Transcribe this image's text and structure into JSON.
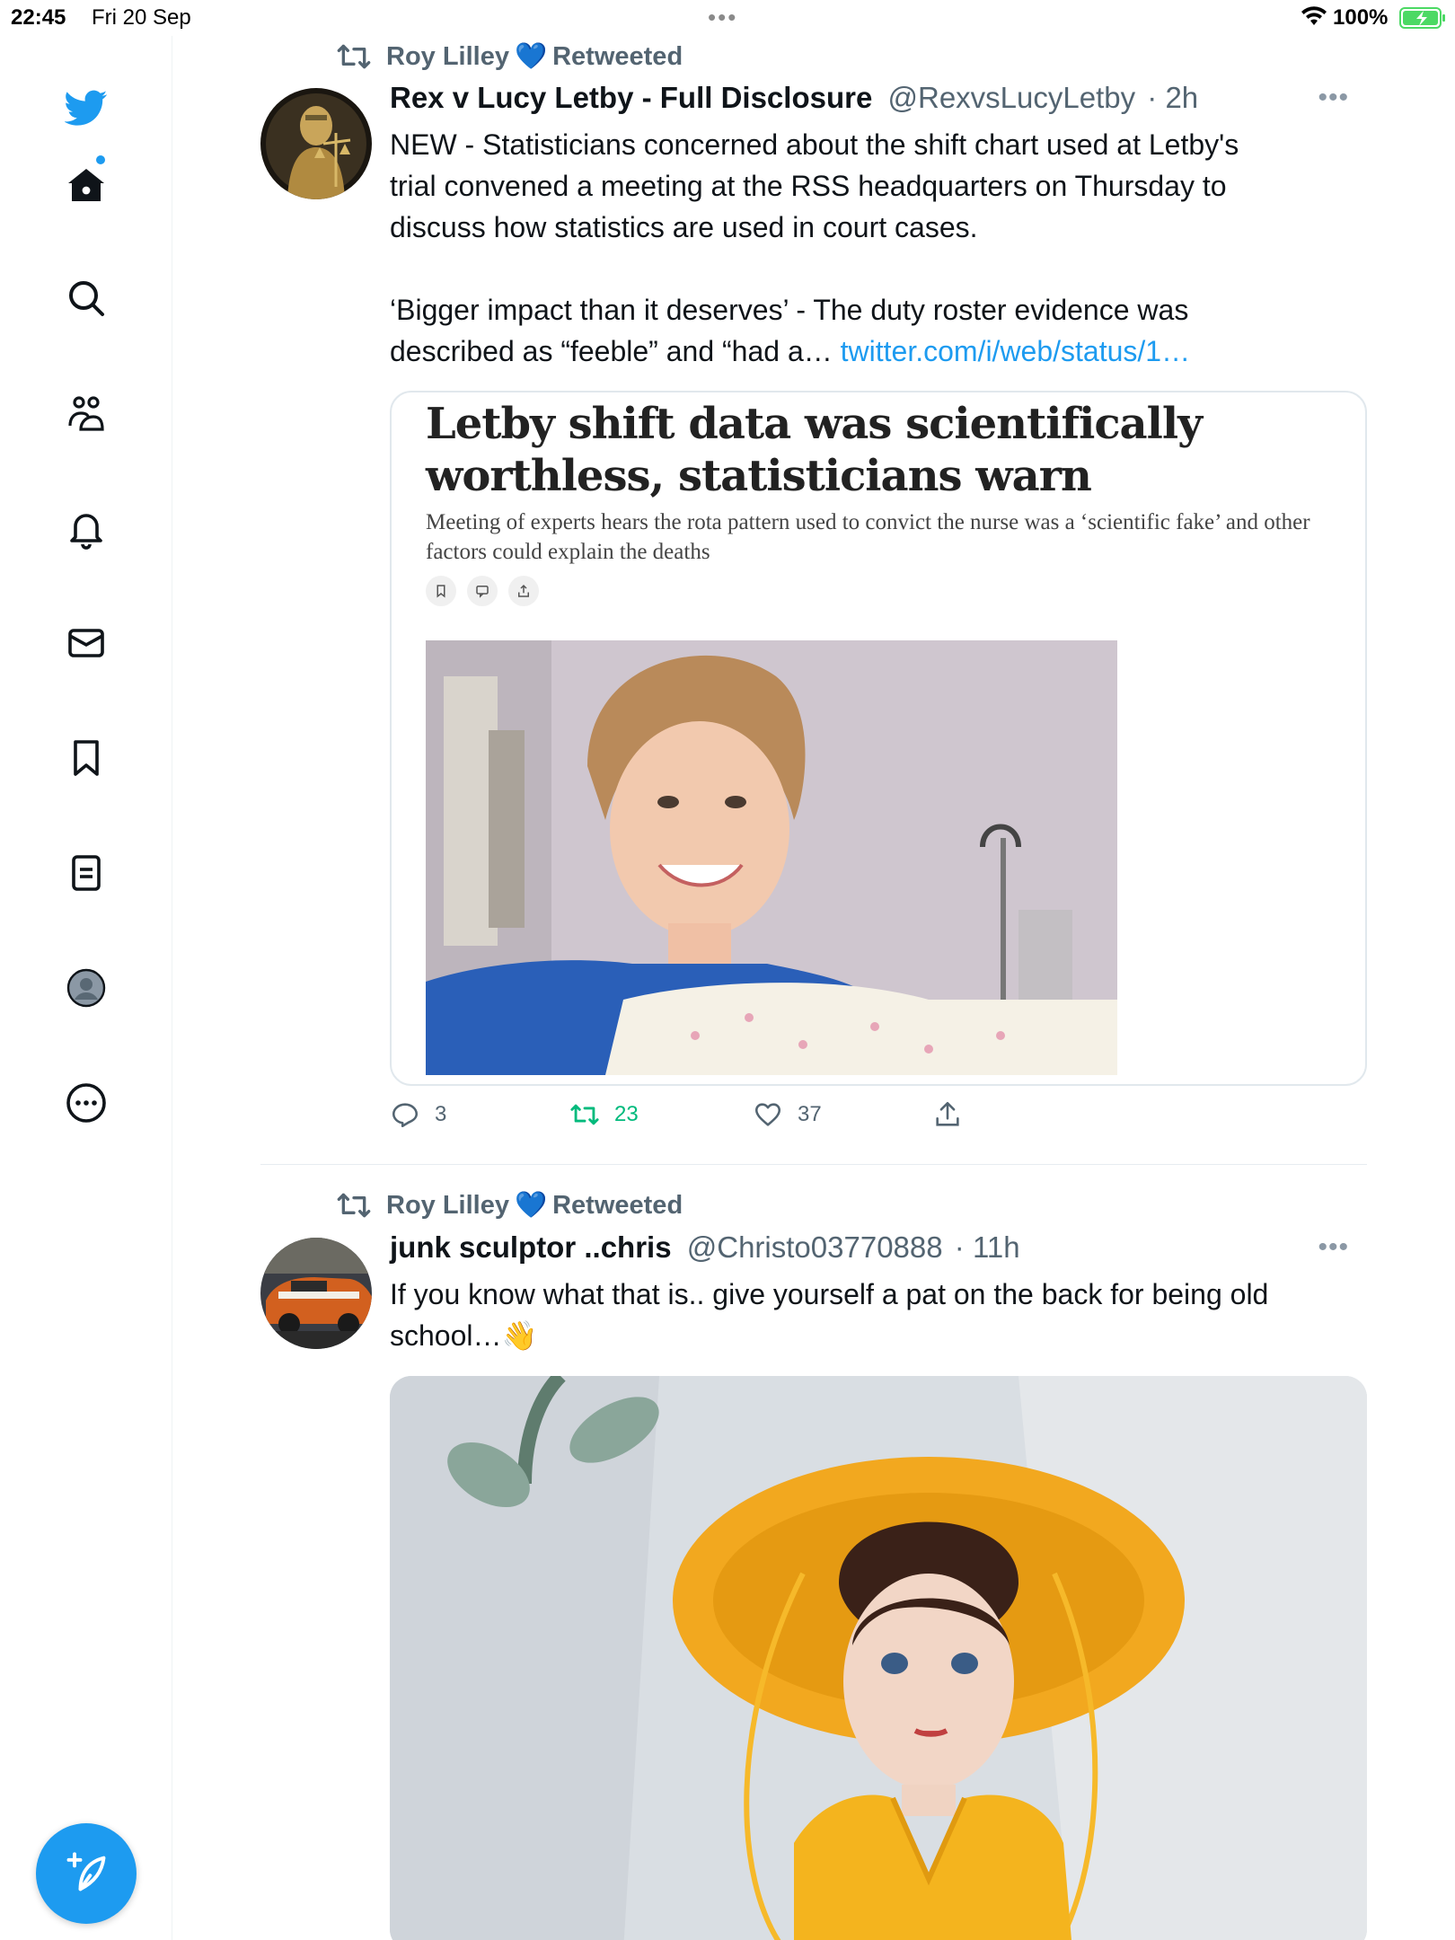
{
  "status_bar": {
    "time": "22:45",
    "date": "Fri 20 Sep",
    "battery": "100%"
  },
  "sidebar": {
    "icons": [
      "twitter-logo-icon",
      "home-icon",
      "search-icon",
      "communities-icon",
      "notifications-icon",
      "messages-icon",
      "bookmarks-icon",
      "lists-icon",
      "profile-icon",
      "more-icon"
    ],
    "compose_icon": "compose-icon"
  },
  "tweets": [
    {
      "retweeted_by": "Roy Lilley",
      "retweeted_label": "Retweeted",
      "name": "Rex v Lucy Letby - Full Disclosure",
      "handle": "@RexvsLucyLetby",
      "time": "· 2h",
      "text_p1_l1": "NEW - Statisticians concerned about the shift chart used at Letby's",
      "text_p1_l2": "trial convened a meeting at the RSS headquarters on Thursday to",
      "text_p1_l3": "discuss how statistics are used in court cases.",
      "text_p2_l1": "‘Bigger impact than it deserves’ - The duty roster evidence was",
      "text_p2_l2": "described as “feeble” and “had a…",
      "link": "twitter.com/i/web/status/1…",
      "card": {
        "headline": "Letby shift data was scientifically worthless, statisticians warn",
        "subhead": "Meeting of experts hears the rota pattern used to convict the nurse was a ‘scientific fake’ and other factors could explain the deaths"
      },
      "replies": "3",
      "retweets": "23",
      "likes": "37"
    },
    {
      "retweeted_by": "Roy Lilley",
      "retweeted_label": "Retweeted",
      "name": "junk sculptor ..chris",
      "handle": "@Christo03770888",
      "time": "· 11h",
      "text_l1": "If you know what that is.. give yourself a pat on the back for being old",
      "text_l2": "school…👋"
    }
  ],
  "colors": {
    "accent": "#1d9bf0",
    "retweet_green": "#00ba7c",
    "secondary_text": "#536471"
  }
}
